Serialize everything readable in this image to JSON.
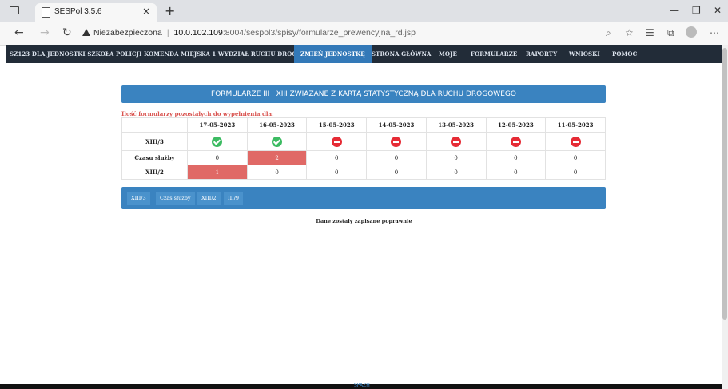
{
  "browser": {
    "tab_title": "SESPol 3.5.6",
    "tab_close": "×",
    "new_tab": "+",
    "security_label": "Niezabezpieczona",
    "url_host": "10.0.102.109",
    "url_path": ":8004/sespol3/spisy/formularze_prewencyjna_rd.jsp"
  },
  "navbar": {
    "unit": "SZ123 DLA JEDNOSTKI SZKOŁA POLICJI KOMENDA MIEJSKA 1 WYDZIAŁ RUCHU DROGOWEGO",
    "change_unit": "ZMIEŃ JEDNOSTKĘ",
    "home": "STRONA GŁÓWNA",
    "mine": "MOJE",
    "forms": "FORMULARZE",
    "reports": "RAPORTY",
    "requests": "WNIOSKI",
    "help": "POMOC"
  },
  "panel_title": "FORMULARZE III I XIII ZWIĄZANE Z KARTĄ STATYSTYCZNĄ DLA RUCHU DROGOWEGO",
  "remaining_label": "Ilość formularzy pozostałych do wypełnienia dla:",
  "table": {
    "dates": [
      "17-05-2023",
      "16-05-2023",
      "15-05-2023",
      "14-05-2023",
      "13-05-2023",
      "12-05-2023",
      "11-05-2023"
    ],
    "row_icons_label": "XIII/3",
    "row_icons": [
      "ok",
      "ok",
      "no",
      "no",
      "no",
      "no",
      "no"
    ],
    "row_service_label": "Czasu służby",
    "row_service": [
      "0",
      "2",
      "0",
      "0",
      "0",
      "0",
      "0"
    ],
    "row_xiii2_label": "XIII/2",
    "row_xiii2": [
      "1",
      "0",
      "0",
      "0",
      "0",
      "0",
      "0"
    ],
    "highlight_color": "#e06966"
  },
  "buttons": {
    "xiii3": "XIII/3",
    "service": "Czas służby",
    "xiii2": "XIII/2",
    "iii9": "III/9"
  },
  "saved_message": "Dane zostały zapisane poprawnie",
  "footer_text": "SPAZH"
}
